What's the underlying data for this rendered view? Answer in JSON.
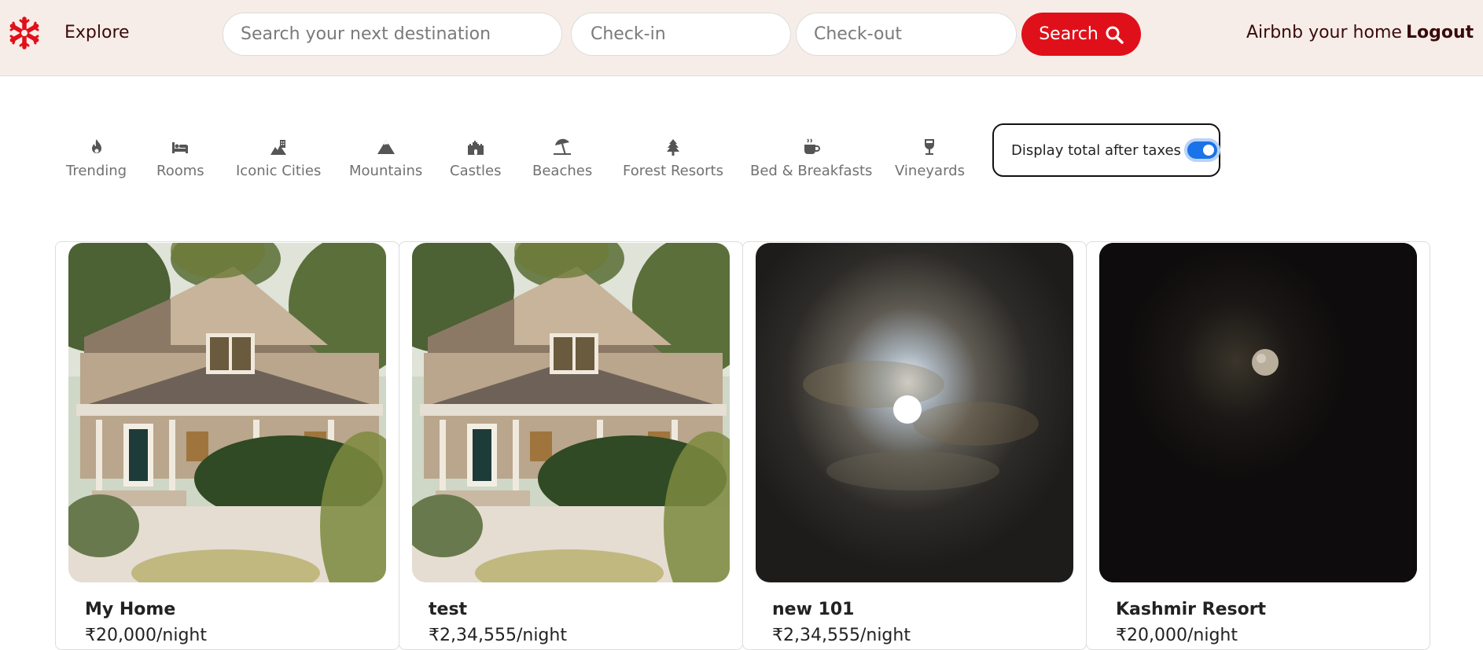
{
  "nav": {
    "explore": "Explore",
    "search_placeholder": "Search your next destination",
    "checkin_placeholder": "Check-in",
    "checkout_placeholder": "Check-out",
    "search_button": "Search",
    "airbnb_home": "Airbnb your home",
    "logout": "Logout",
    "brand_color": "#e0101a"
  },
  "filters": [
    {
      "label": "Trending",
      "icon": "fire-icon"
    },
    {
      "label": "Rooms",
      "icon": "bed-icon"
    },
    {
      "label": "Iconic Cities",
      "icon": "city-icon"
    },
    {
      "label": "Mountains",
      "icon": "mountain-icon"
    },
    {
      "label": "Castles",
      "icon": "castle-icon"
    },
    {
      "label": "Beaches",
      "icon": "umbrella-beach-icon"
    },
    {
      "label": "Forest Resorts",
      "icon": "tree-icon"
    },
    {
      "label": "Bed & Breakfasts",
      "icon": "mug-icon"
    },
    {
      "label": "Vineyards",
      "icon": "wine-glass-icon"
    }
  ],
  "tax_toggle": {
    "label": "Display total after taxes",
    "enabled": true
  },
  "listings": [
    {
      "title": "My Home",
      "price": "₹20,000/night",
      "image": "house-photo"
    },
    {
      "title": "test",
      "price": "₹2,34,555/night",
      "image": "house-photo"
    },
    {
      "title": "new 101",
      "price": "₹2,34,555/night",
      "image": "moon-clouds-photo"
    },
    {
      "title": "Kashmir Resort",
      "price": "₹20,000/night",
      "image": "dark-moon-photo"
    }
  ]
}
